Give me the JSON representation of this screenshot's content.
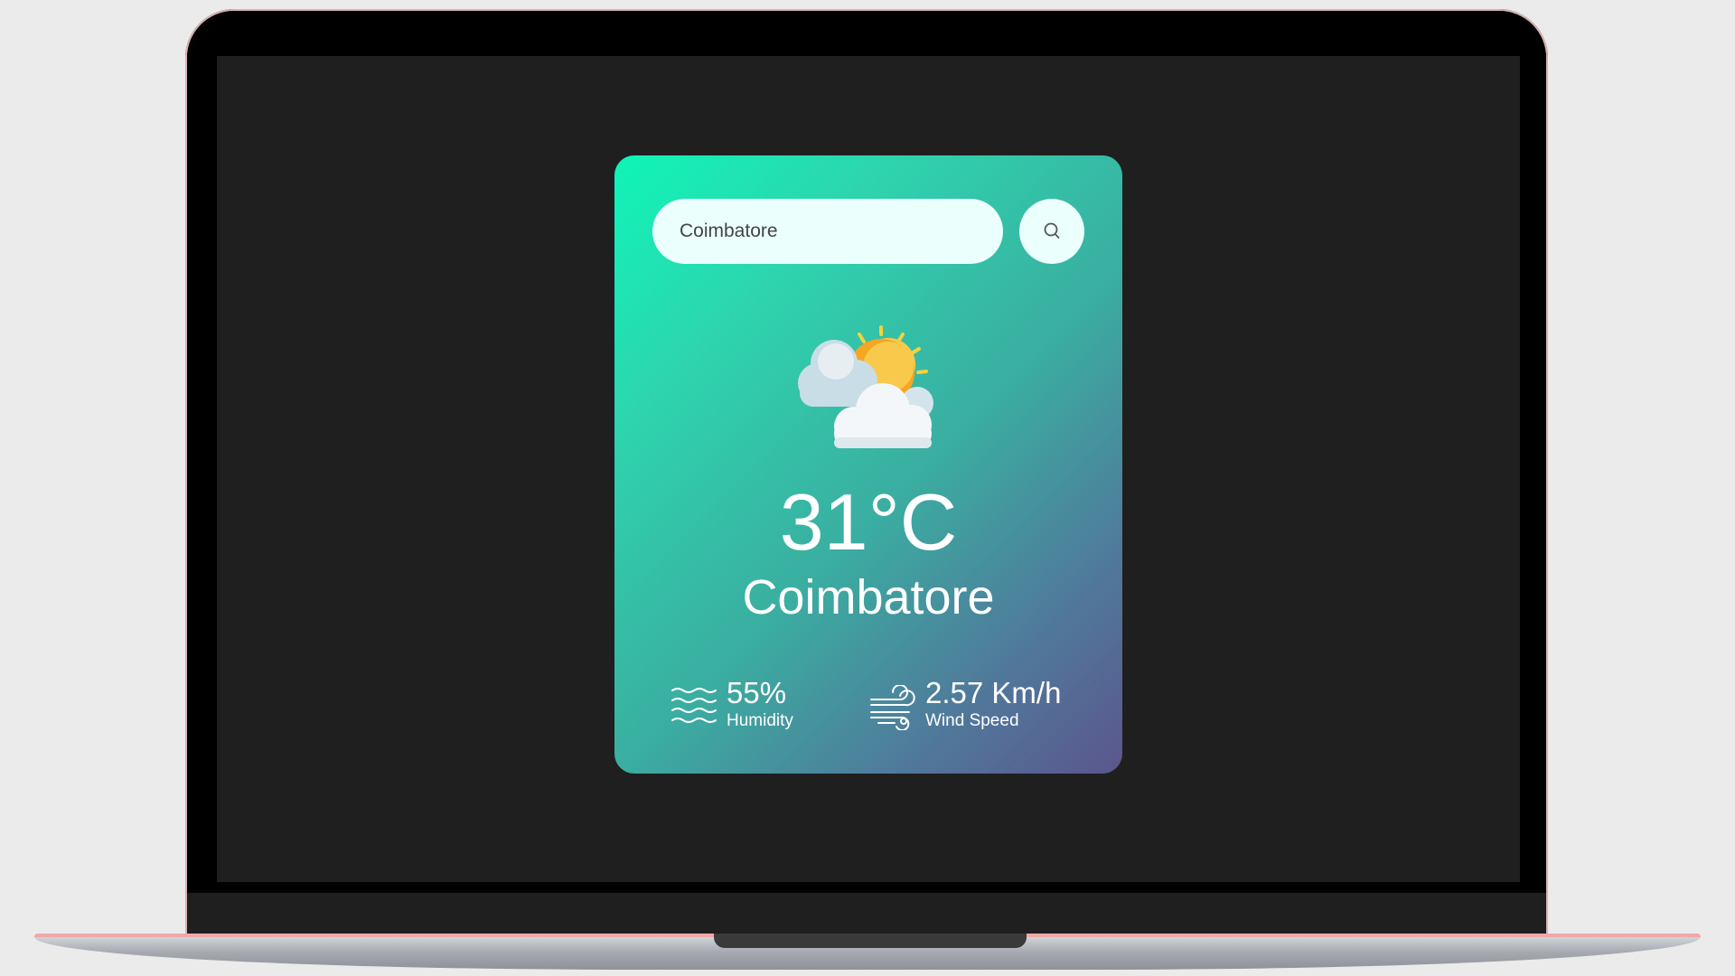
{
  "search": {
    "value": "Coimbatore",
    "button_icon": "search-icon"
  },
  "weather": {
    "condition_icon": "partly-cloudy-sun-icon",
    "temperature": "31°C",
    "city": "Coimbatore"
  },
  "humidity": {
    "icon": "humidity-waves-icon",
    "value": "55%",
    "label": "Humidity"
  },
  "wind": {
    "icon": "wind-icon",
    "value": "2.57 Km/h",
    "label": "Wind Speed"
  },
  "colors": {
    "card_gradient_start": "#0ff5b8",
    "card_gradient_end": "#5b568d",
    "input_bg": "#ebfffd",
    "screen_bg": "#1f1f1f"
  }
}
